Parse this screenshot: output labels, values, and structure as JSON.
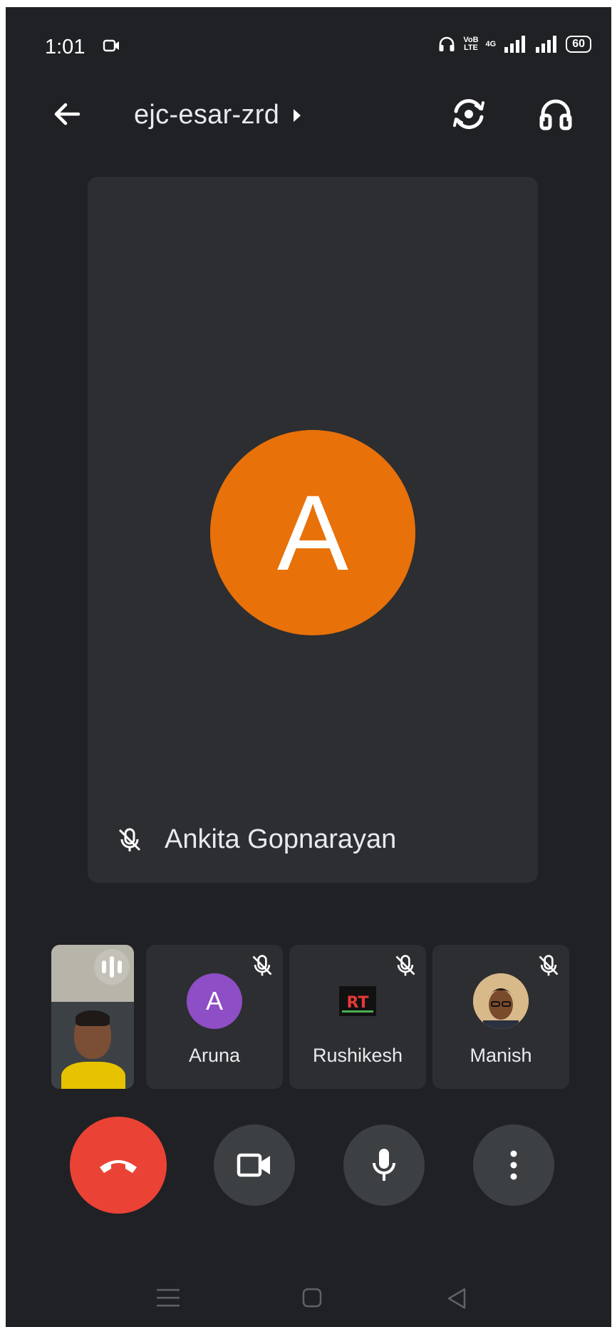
{
  "status_bar": {
    "time": "1:01",
    "volte_top": "VoB",
    "volte_bottom": "LTE",
    "network": "4G",
    "battery": "60"
  },
  "top_bar": {
    "meeting_code": "ejc-esar-zrd"
  },
  "main_tile": {
    "avatar_letter": "A",
    "participant_name": "Ankita Gopnarayan",
    "muted": true,
    "avatar_color": "#e8710a"
  },
  "participants": [
    {
      "name": "Aruna",
      "avatar_letter": "A",
      "muted": true,
      "avatar_color": "#8e4ec6"
    },
    {
      "name": "Rushikesh",
      "avatar_text": "RT",
      "muted": true
    },
    {
      "name": "Manish",
      "muted": true
    }
  ],
  "colors": {
    "background": "#202124",
    "tile": "#2d2e31",
    "control": "#3c4043",
    "end_call": "#ea4335"
  },
  "icons": [
    "camera-icon",
    "back-arrow-icon",
    "play-arrow-icon",
    "switch-camera-icon",
    "headphones-icon",
    "mic-off-icon",
    "audio-level-icon",
    "end-call-icon",
    "video-icon",
    "mic-icon",
    "more-vert-icon",
    "menu-icon",
    "home-icon",
    "nav-back-icon"
  ]
}
